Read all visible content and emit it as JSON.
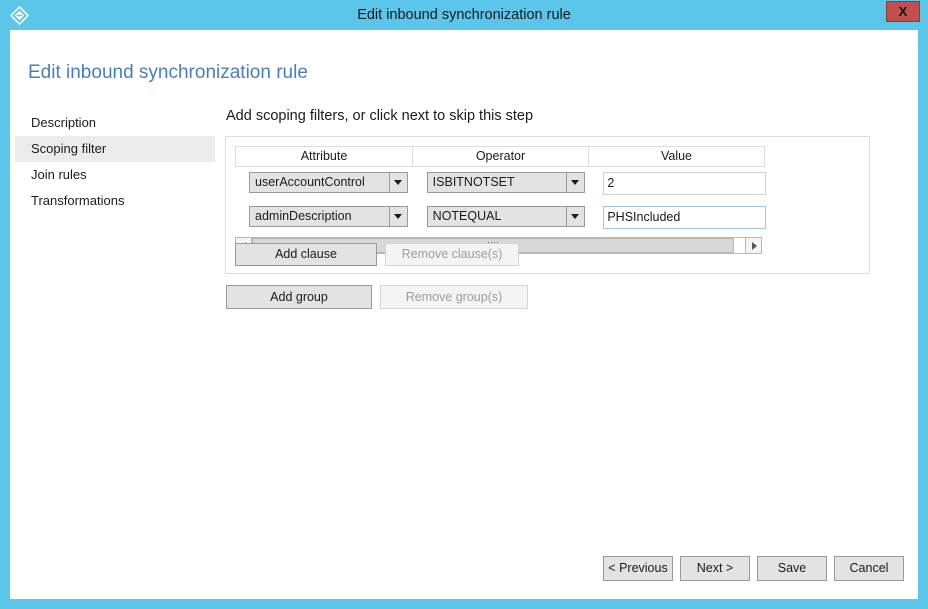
{
  "window": {
    "title": "Edit inbound synchronization rule",
    "app_icon": "sync-rule-diamond-icon",
    "close_label": "X",
    "accent_color": "#5BC5EA",
    "close_color": "#C1504D"
  },
  "page": {
    "heading": "Edit inbound synchronization rule",
    "heading_color": "#4a7ebb"
  },
  "nav": {
    "items": [
      {
        "label": "Description",
        "selected": false
      },
      {
        "label": "Scoping filter",
        "selected": true
      },
      {
        "label": "Join rules",
        "selected": false
      },
      {
        "label": "Transformations",
        "selected": false
      }
    ],
    "selected_background": "#ebebeb"
  },
  "main": {
    "instruction": "Add scoping filters, or click next to skip this step",
    "table": {
      "columns": [
        "Attribute",
        "Operator",
        "Value"
      ],
      "rows": [
        {
          "attribute": "userAccountControl",
          "operator": "ISBITNOTSET",
          "value": "2",
          "value_focused": false
        },
        {
          "attribute": "adminDescription",
          "operator": "NOTEQUAL",
          "value": "PHSIncluded",
          "value_focused": true
        }
      ]
    },
    "scrollbar": {
      "left_arrow": "chevron-left-icon",
      "right_arrow": "chevron-right-icon"
    },
    "clause_buttons": {
      "add": {
        "label": "Add clause",
        "disabled": false
      },
      "remove": {
        "label": "Remove clause(s)",
        "disabled": true
      }
    },
    "group_buttons": {
      "add": {
        "label": "Add group",
        "disabled": false
      },
      "remove": {
        "label": "Remove group(s)",
        "disabled": true
      }
    }
  },
  "footer": {
    "buttons": [
      {
        "label": "< Previous"
      },
      {
        "label": "Next >"
      },
      {
        "label": "Save"
      },
      {
        "label": "Cancel"
      }
    ]
  }
}
